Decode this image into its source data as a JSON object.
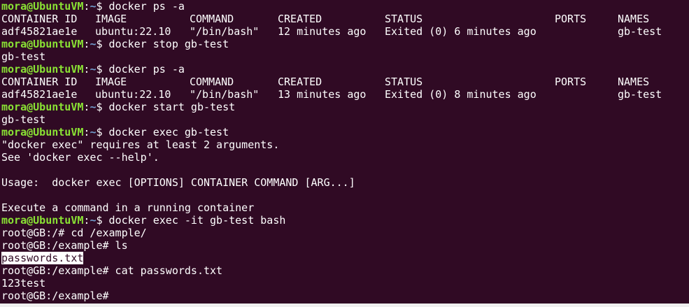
{
  "colors": {
    "background": "#300a24",
    "user_host": "#8ae234",
    "path": "#729fcf",
    "text": "#ffffff"
  },
  "prompt": {
    "user_host": "mora@UbuntuVM",
    "colon": ":",
    "path": "~",
    "dollar": "$ "
  },
  "table_headers": [
    "CONTAINER ID",
    "IMAGE",
    "COMMAND",
    "CREATED",
    "STATUS",
    "PORTS",
    "NAMES"
  ],
  "lines": {
    "cmd1": "docker ps -a",
    "row1": [
      "adf45821ae1e",
      "ubuntu:22.10",
      "\"/bin/bash\"",
      "12 minutes ago",
      "Exited (0) 6 minutes ago",
      "",
      "gb-test"
    ],
    "cmd2": "docker stop gb-test",
    "out2": "gb-test",
    "cmd3": "docker ps -a",
    "row2": [
      "adf45821ae1e",
      "ubuntu:22.10",
      "\"/bin/bash\"",
      "13 minutes ago",
      "Exited (0) 8 minutes ago",
      "",
      "gb-test"
    ],
    "cmd4": "docker start gb-test",
    "out4": "gb-test",
    "cmd5": "docker exec gb-test",
    "err1": "\"docker exec\" requires at least 2 arguments.",
    "err2": "See 'docker exec --help'.",
    "usage": "Usage:  docker exec [OPTIONS] CONTAINER COMMAND [ARG...]",
    "desc": "Execute a command in a running container",
    "cmd6": "docker exec -it gb-test bash",
    "root1": "root@GB:/# cd /example/",
    "root2": "root@GB:/example# ls",
    "file": "passwords.txt",
    "root3": "root@GB:/example# cat passwords.txt",
    "content": "123test",
    "root4": "root@GB:/example#"
  }
}
